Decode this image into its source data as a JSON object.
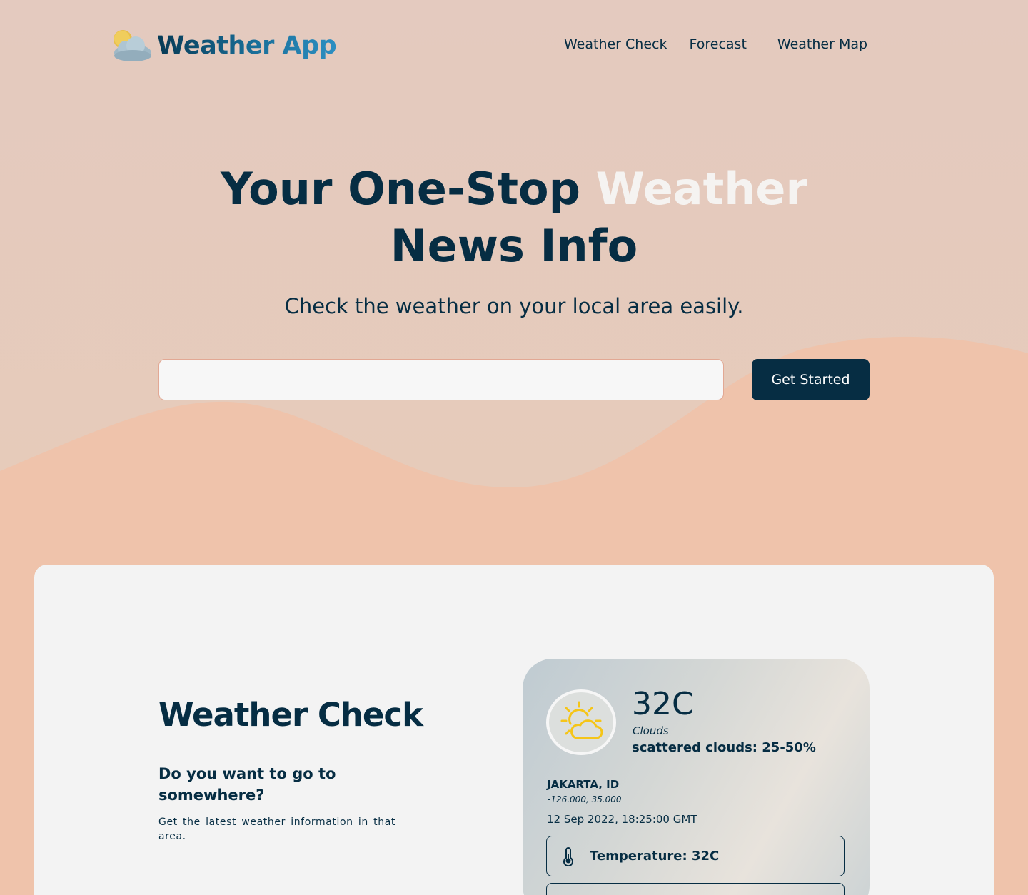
{
  "header": {
    "app_name": "Weather App",
    "logo_icon": "sun-cloud-icon",
    "nav": [
      {
        "label": "Weather Check"
      },
      {
        "label": "Forecast"
      },
      {
        "label": "Weather Map"
      }
    ]
  },
  "hero": {
    "title_part1": "Your One-Stop ",
    "title_highlight": "Weather",
    "title_part2": " News Info",
    "subtitle": "Check the weather on your local area easily.",
    "search_value": "",
    "search_placeholder": "",
    "cta_label": "Get Started"
  },
  "weather_check": {
    "title": "Weather Check",
    "question": "Do you want to go to somewhere?",
    "description": "Get the latest weather information in that area."
  },
  "card": {
    "icon": "partly-cloudy-icon",
    "temperature": "32C",
    "condition": "Clouds",
    "condition_desc": "scattered clouds: 25-50%",
    "city": "JAKARTA, ID",
    "coords": "-126.000, 35.000",
    "datetime": "12 Sep 2022, 18:25:00 GMT",
    "rows": [
      {
        "icon": "thermometer-icon",
        "label": "Temperature: 32C"
      },
      {
        "icon": "",
        "label": ""
      }
    ]
  },
  "colors": {
    "primary": "#062d43",
    "background": "#efc3ab",
    "highlight": "#f5f3f1",
    "accent_yellow": "#f5c518"
  }
}
